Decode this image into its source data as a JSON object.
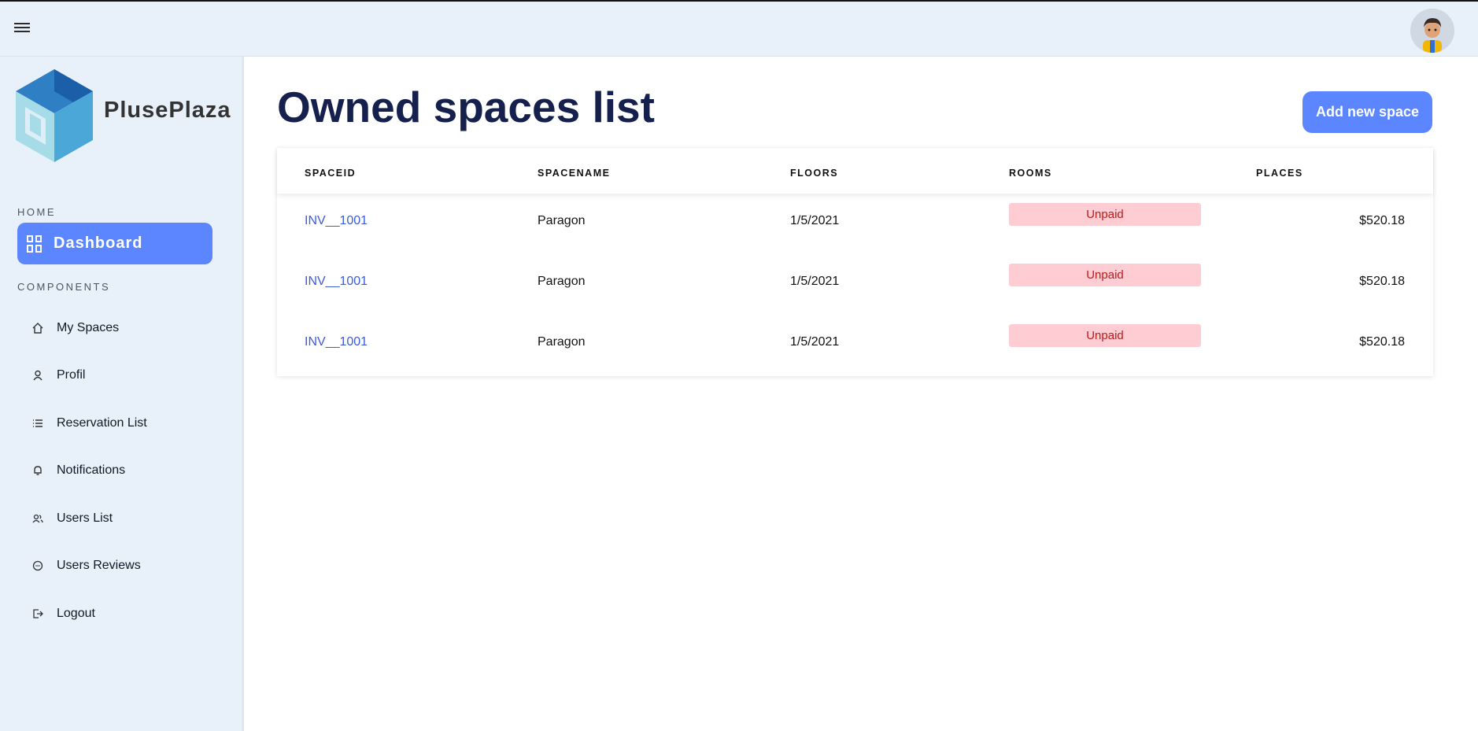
{
  "app": {
    "brand": "PlusePlaza"
  },
  "sidebar": {
    "home_title": "HOME",
    "dashboard_label": "Dashboard",
    "components_title": "COMPONENTS",
    "items": [
      {
        "label": "My Spaces",
        "icon": "home-icon"
      },
      {
        "label": "Profil",
        "icon": "user-icon"
      },
      {
        "label": "Reservation List",
        "icon": "list-icon"
      },
      {
        "label": "Notifications",
        "icon": "bell-icon"
      },
      {
        "label": "Users List",
        "icon": "users-icon"
      },
      {
        "label": "Users Reviews",
        "icon": "chat-icon"
      },
      {
        "label": "Logout",
        "icon": "logout-icon"
      }
    ]
  },
  "main": {
    "title": "Owned spaces list",
    "add_button": "Add new space",
    "columns": [
      "SPACEID",
      "SPACENAME",
      "FLOORS",
      "ROOMS",
      "PLACES"
    ],
    "rows": [
      {
        "id": "INV__1001",
        "name": "Paragon",
        "floors": "1/5/2021",
        "rooms": "Unpaid",
        "places": "$520.18"
      },
      {
        "id": "INV__1001",
        "name": "Paragon",
        "floors": "1/5/2021",
        "rooms": "Unpaid",
        "places": "$520.18"
      },
      {
        "id": "INV__1001",
        "name": "Paragon",
        "floors": "1/5/2021",
        "rooms": "Unpaid",
        "places": "$520.18"
      }
    ]
  },
  "colors": {
    "accent": "#5b86ff",
    "sidebar_bg": "#e8f1fa",
    "title": "#16204d",
    "badge_bg": "#fecdd3",
    "badge_text": "#b91c1c"
  }
}
